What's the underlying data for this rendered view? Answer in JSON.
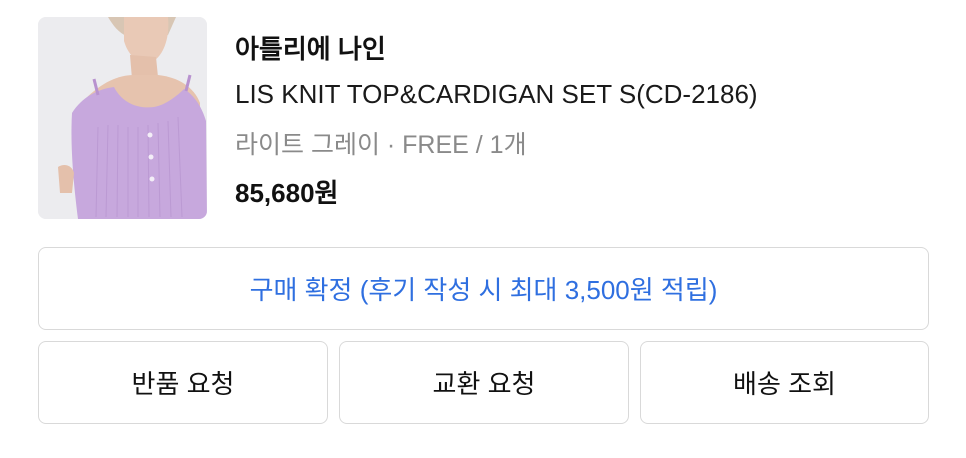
{
  "product": {
    "brand": "아틀리에 나인",
    "name": "LIS KNIT TOP&CARDIGAN SET S(CD-2186)",
    "option": "라이트 그레이 · FREE / 1개",
    "price": "85,680원",
    "image_alt": "product-thumbnail"
  },
  "actions": {
    "confirm_label": "구매 확정 (후기 작성 시 최대 3,500원 적립)",
    "return_label": "반품 요청",
    "exchange_label": "교환 요청",
    "delivery_label": "배송 조회"
  },
  "colors": {
    "accent": "#2f6fe0",
    "border": "#d9d9d9",
    "muted_text": "#8a8a8a",
    "thumb_bg": "#ededf0",
    "garment": "#c9a9de"
  }
}
